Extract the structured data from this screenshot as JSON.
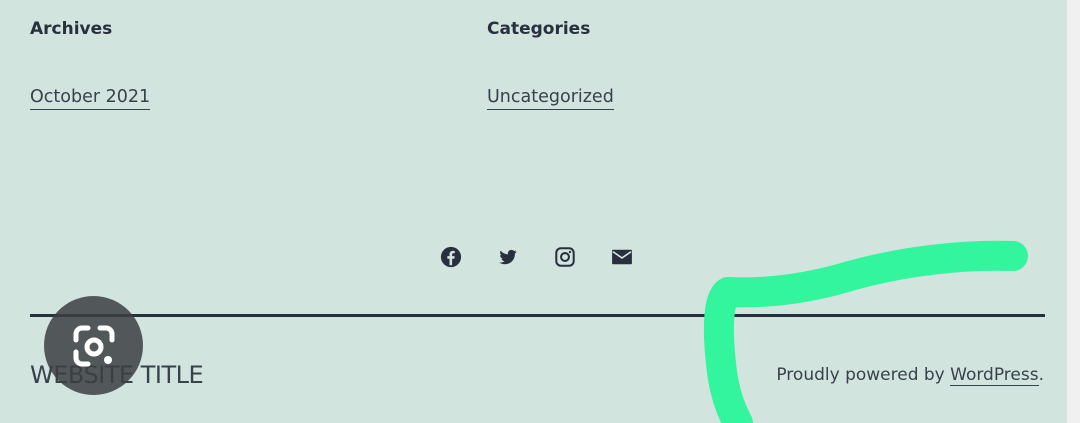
{
  "widgets": {
    "archives": {
      "title": "Archives",
      "link": "October 2021"
    },
    "categories": {
      "title": "Categories",
      "link": "Uncategorized"
    }
  },
  "social": [
    {
      "icon": "facebook-icon"
    },
    {
      "icon": "twitter-icon"
    },
    {
      "icon": "instagram-icon"
    },
    {
      "icon": "mail-icon"
    }
  ],
  "footer": {
    "site_title": "WEBSITE TITLE",
    "powered_prefix": "Proudly powered by ",
    "powered_link": "WordPress",
    "powered_suffix": "."
  },
  "overlay": {
    "icon": "google-lens-icon"
  },
  "colors": {
    "background": "#d1e4dd",
    "text": "#28303d",
    "highlight_stroke": "#33f59d",
    "lens_button": "#3c4043"
  }
}
